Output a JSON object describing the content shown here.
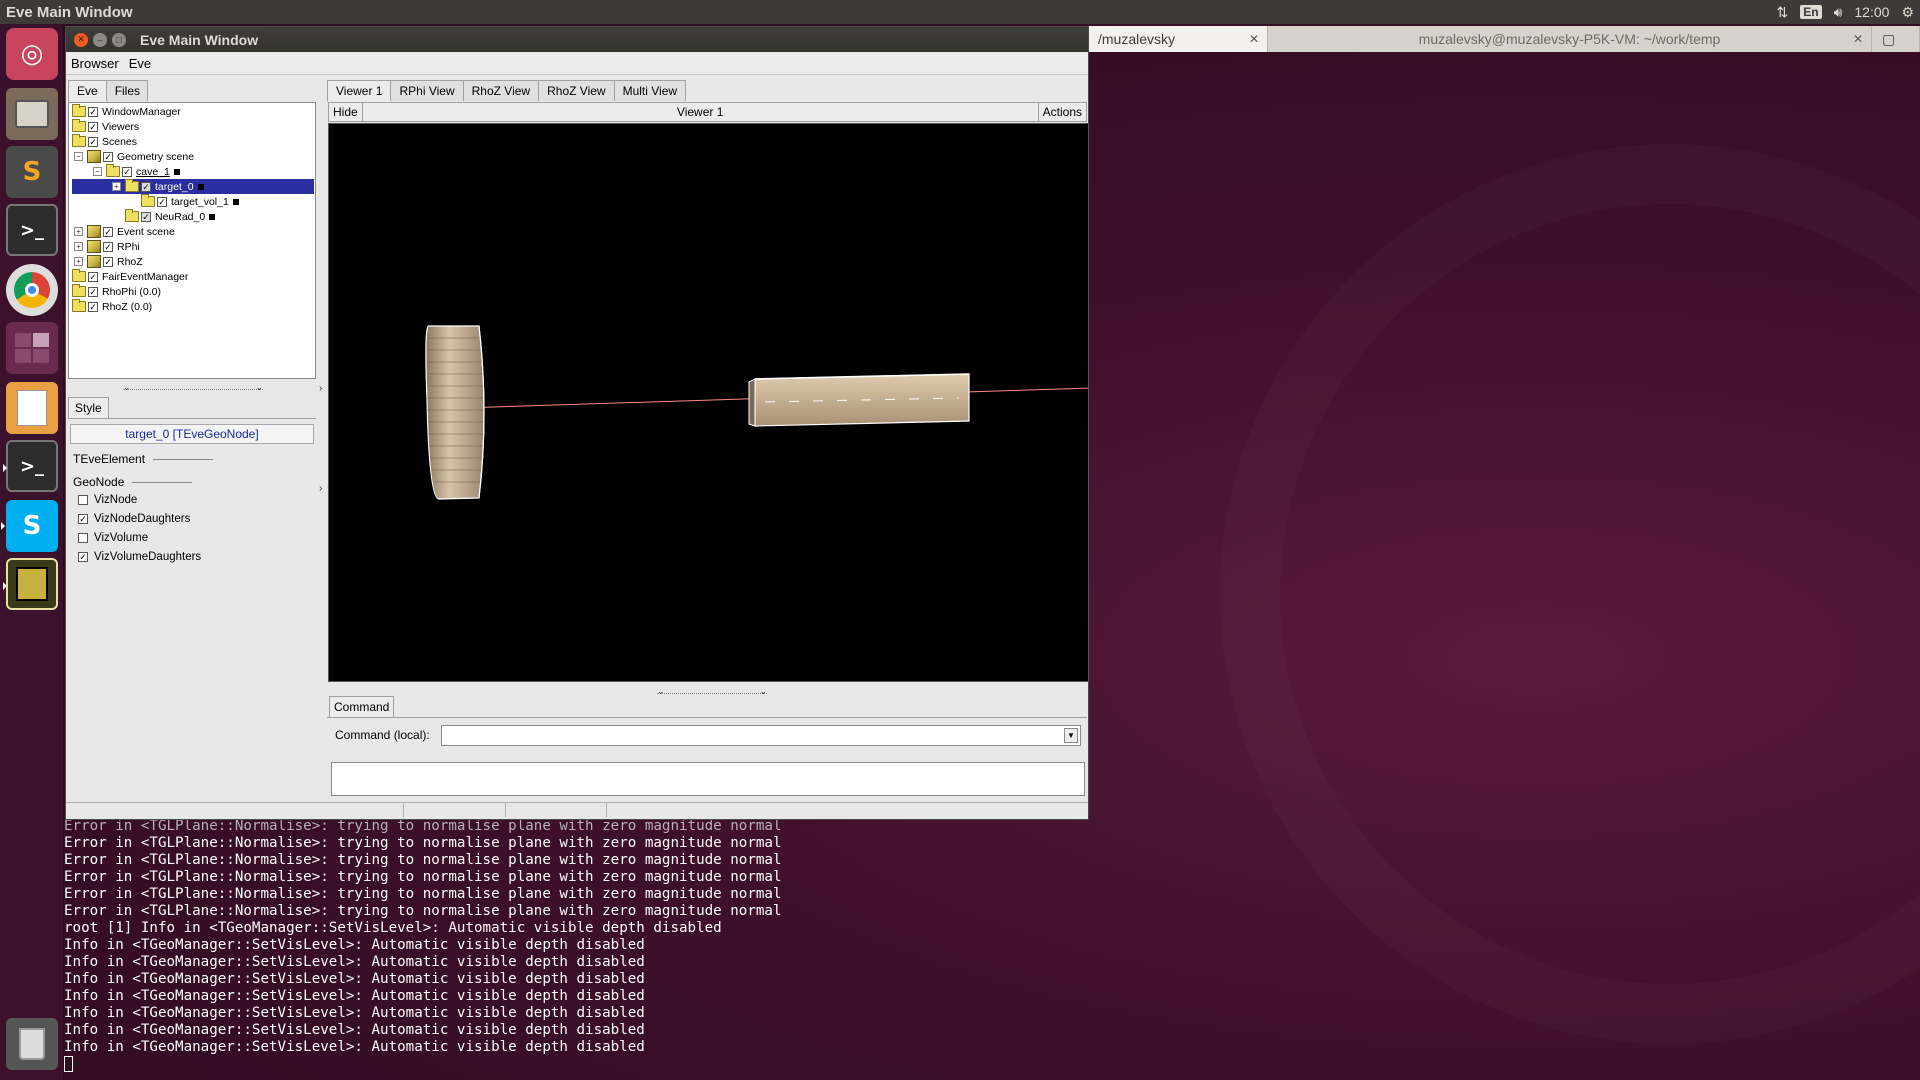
{
  "top_panel": {
    "app_title": "Eve Main Window",
    "lang": "En",
    "clock": "12:00"
  },
  "terminal_tabs": {
    "tab1": "/muzalevsky",
    "tab2": "muzalevsky@muzalevsky-P5K-VM: ~/work/temp"
  },
  "eve": {
    "title": "Eve Main Window",
    "menu": [
      "Browser",
      "Eve"
    ],
    "left_tabs": [
      "Eve",
      "Files"
    ],
    "tree": [
      {
        "label": "WindowManager"
      },
      {
        "label": "Viewers"
      },
      {
        "label": "Scenes"
      },
      {
        "label": "Geometry scene"
      },
      {
        "label": "cave_1"
      },
      {
        "label": "target_0"
      },
      {
        "label": "target_vol_1"
      },
      {
        "label": "NeuRad_0"
      },
      {
        "label": "Event scene"
      },
      {
        "label": "RPhi"
      },
      {
        "label": "RhoZ"
      },
      {
        "label": "FairEventManager"
      },
      {
        "label": "RhoPhi (0.0)"
      },
      {
        "label": "RhoZ (0.0)"
      }
    ],
    "style_tab": "Style",
    "node_title": "target_0 [TEveGeoNode]",
    "sections": {
      "element": "TEveElement",
      "geonode": "GeoNode"
    },
    "checkboxes": [
      {
        "label": "VizNode",
        "checked": false
      },
      {
        "label": "VizNodeDaughters",
        "checked": true
      },
      {
        "label": "VizVolume",
        "checked": false
      },
      {
        "label": "VizVolumeDaughters",
        "checked": true
      }
    ],
    "viewer_tabs": [
      "Viewer 1",
      "RPhi View",
      "RhoZ View",
      "RhoZ View",
      "Multi View"
    ],
    "hide_label": "Hide",
    "viewer_label": "Viewer 1",
    "actions_label": "Actions",
    "command_tab": "Command",
    "command_label": "Command (local):"
  },
  "terminal": {
    "lines": [
      "Error in <TGLPlane::Normalise>: trying to normalise plane with zero magnitude normal",
      "Error in <TGLPlane::Normalise>: trying to normalise plane with zero magnitude normal",
      "Error in <TGLPlane::Normalise>: trying to normalise plane with zero magnitude normal",
      "Error in <TGLPlane::Normalise>: trying to normalise plane with zero magnitude normal",
      "Error in <TGLPlane::Normalise>: trying to normalise plane with zero magnitude normal",
      "Error in <TGLPlane::Normalise>: trying to normalise plane with zero magnitude normal",
      "root [1] Info in <TGeoManager::SetVisLevel>: Automatic visible depth disabled",
      "Info in <TGeoManager::SetVisLevel>: Automatic visible depth disabled",
      "Info in <TGeoManager::SetVisLevel>: Automatic visible depth disabled",
      "Info in <TGeoManager::SetVisLevel>: Automatic visible depth disabled",
      "Info in <TGeoManager::SetVisLevel>: Automatic visible depth disabled",
      "Info in <TGeoManager::SetVisLevel>: Automatic visible depth disabled",
      "Info in <TGeoManager::SetVisLevel>: Automatic visible depth disabled",
      "Info in <TGeoManager::SetVisLevel>: Automatic visible depth disabled"
    ]
  },
  "colors": {
    "selection": "#2a2ea0",
    "close_button": "#f05b2a",
    "geometry": "#c8b496",
    "beam_line": "#ff8a80"
  },
  "launcher_icons": [
    "ubuntu-dash-icon",
    "files-icon",
    "sublime-icon",
    "terminal-icon",
    "chrome-icon",
    "workspace-icon",
    "text-editor-icon",
    "terminal-icon-2",
    "skype-icon",
    "app-icon",
    "trash-icon"
  ]
}
